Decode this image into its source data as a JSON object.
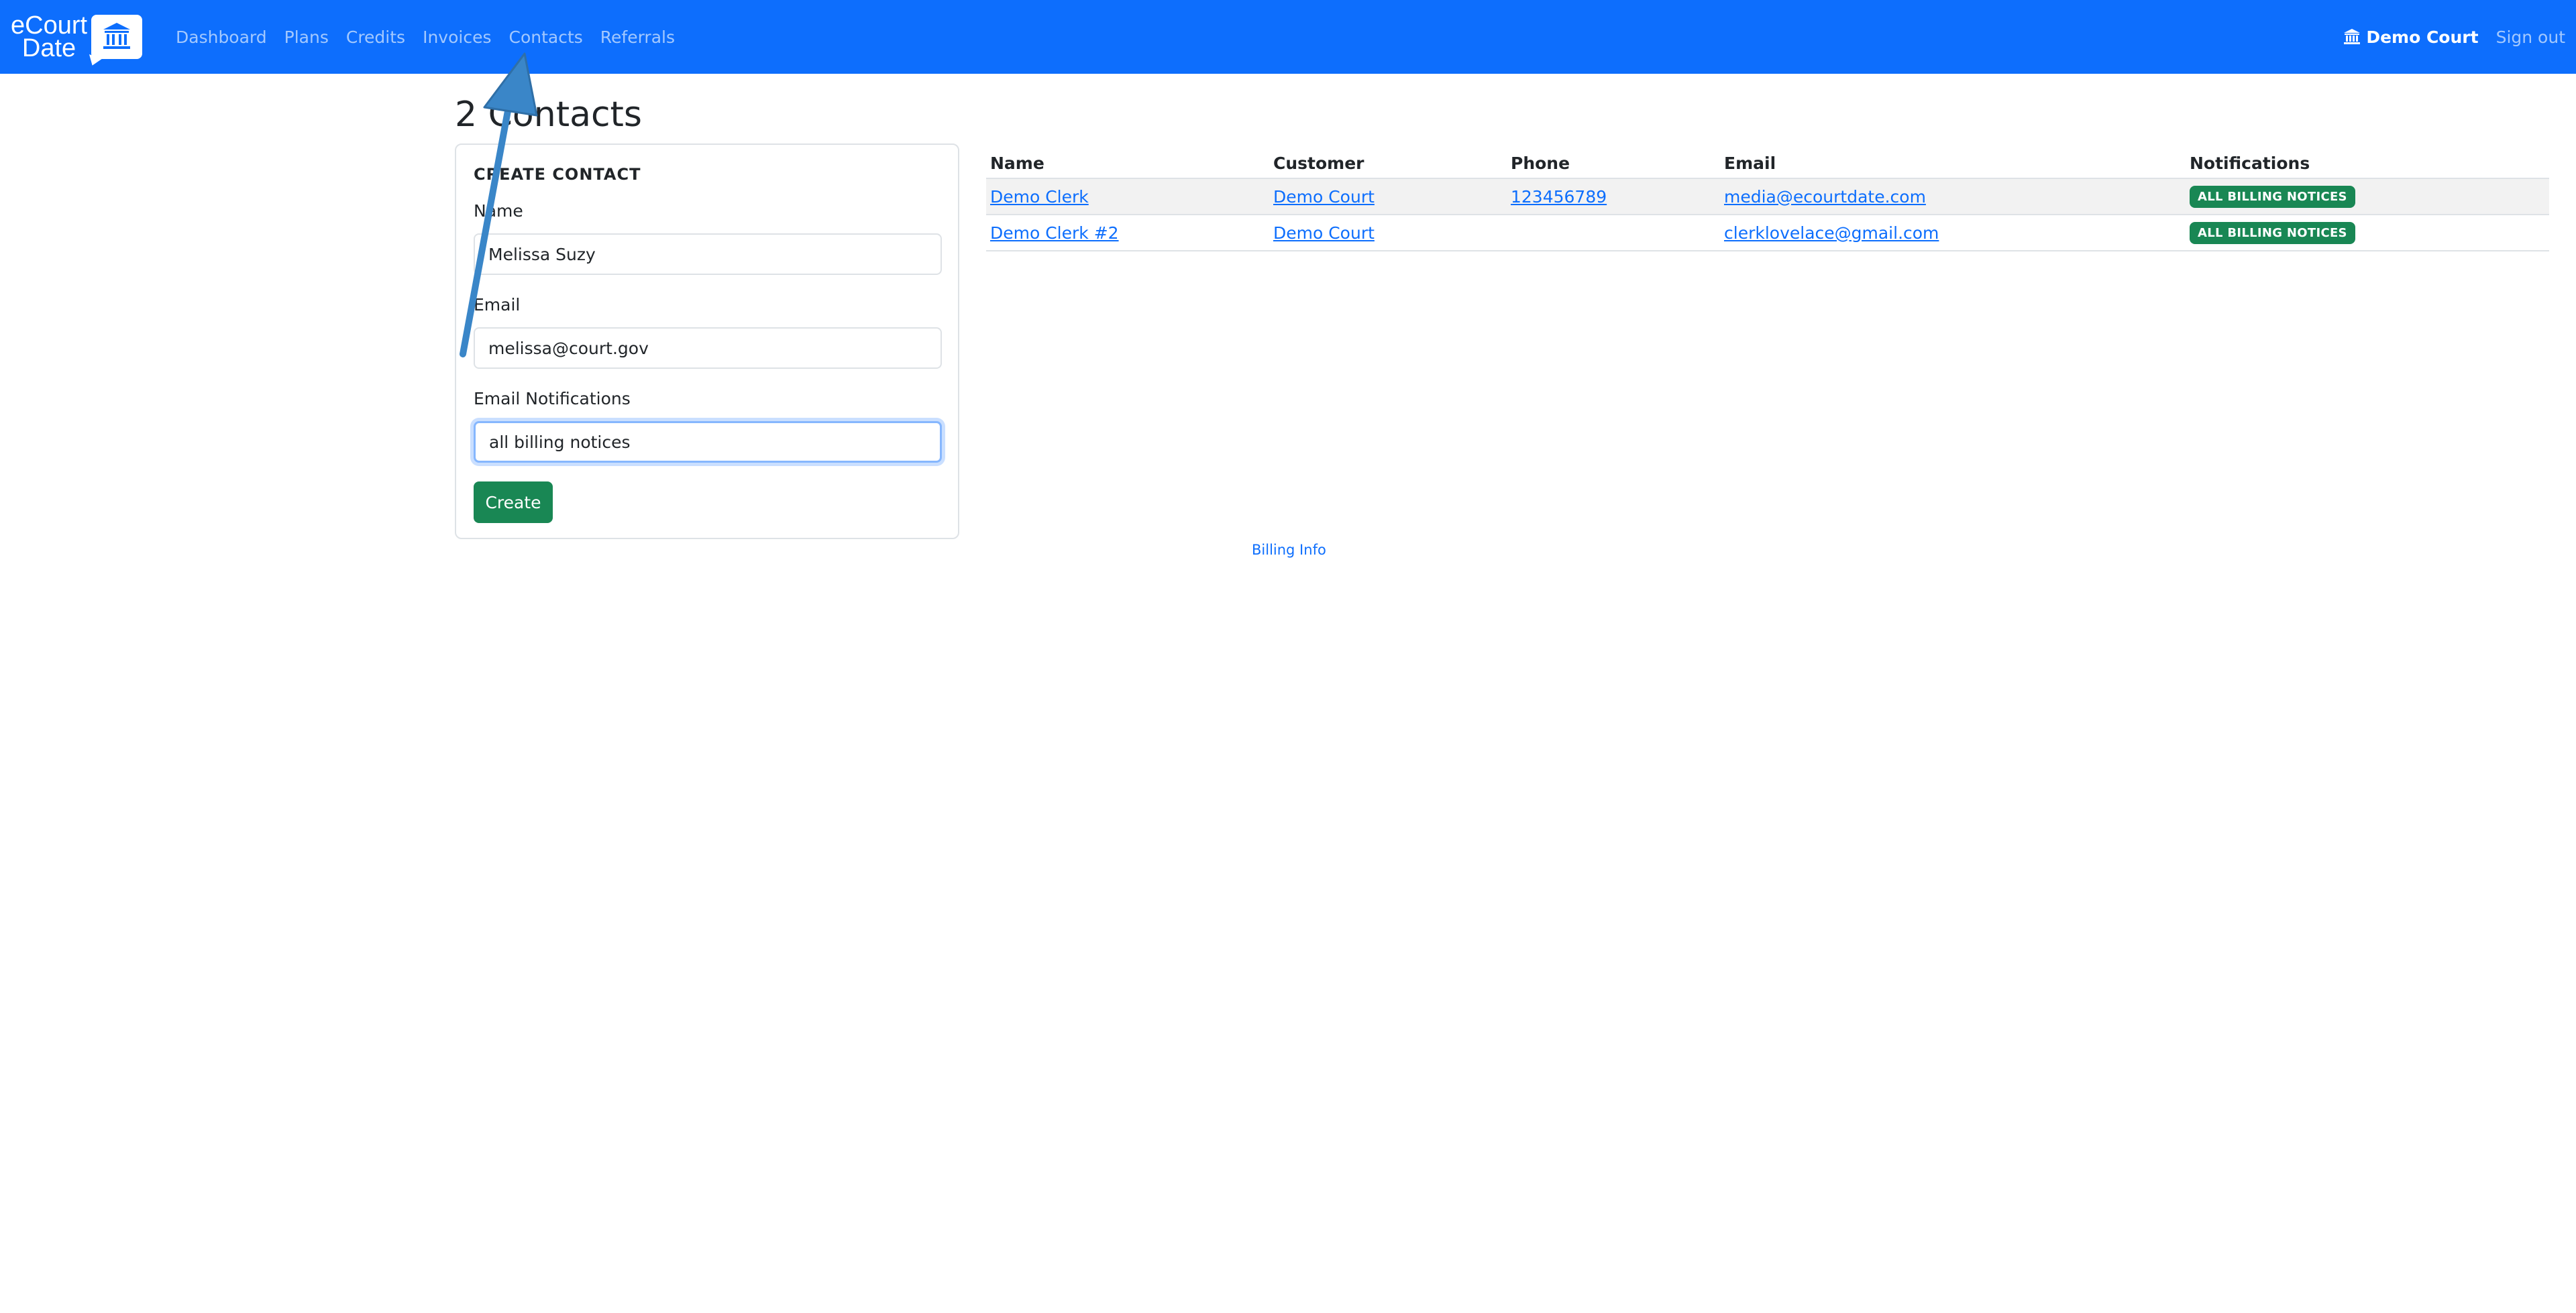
{
  "brand": {
    "line1": "eCourt",
    "line2": "Date",
    "icon": "courthouse-icon"
  },
  "nav": {
    "links": [
      {
        "label": "Dashboard"
      },
      {
        "label": "Plans"
      },
      {
        "label": "Credits"
      },
      {
        "label": "Invoices"
      },
      {
        "label": "Contacts"
      },
      {
        "label": "Referrals"
      }
    ],
    "court_name": "Demo Court",
    "court_icon": "courthouse-icon",
    "signout": "Sign out"
  },
  "page": {
    "title": "2 Contacts"
  },
  "create_form": {
    "title": "CREATE CONTACT",
    "name_label": "Name",
    "name_value": "Melissa Suzy",
    "email_label": "Email",
    "email_value": "melissa@court.gov",
    "notifications_label": "Email Notifications",
    "notifications_value": "all billing notices",
    "submit_label": "Create"
  },
  "table": {
    "headers": [
      "Name",
      "Customer",
      "Phone",
      "Email",
      "Notifications"
    ],
    "rows": [
      {
        "name": "Demo Clerk",
        "customer": "Demo Court",
        "phone": "123456789",
        "email": "media@ecourtdate.com",
        "notifications": "ALL BILLING NOTICES"
      },
      {
        "name": "Demo Clerk #2",
        "customer": "Demo Court",
        "phone": "",
        "email": "clerklovelace@gmail.com",
        "notifications": "ALL BILLING NOTICES"
      }
    ]
  },
  "footer": {
    "billing_info": "Billing Info"
  },
  "colors": {
    "primary": "#0d6efd",
    "success": "#198754",
    "annotation_arrow": "#3a86c8"
  }
}
